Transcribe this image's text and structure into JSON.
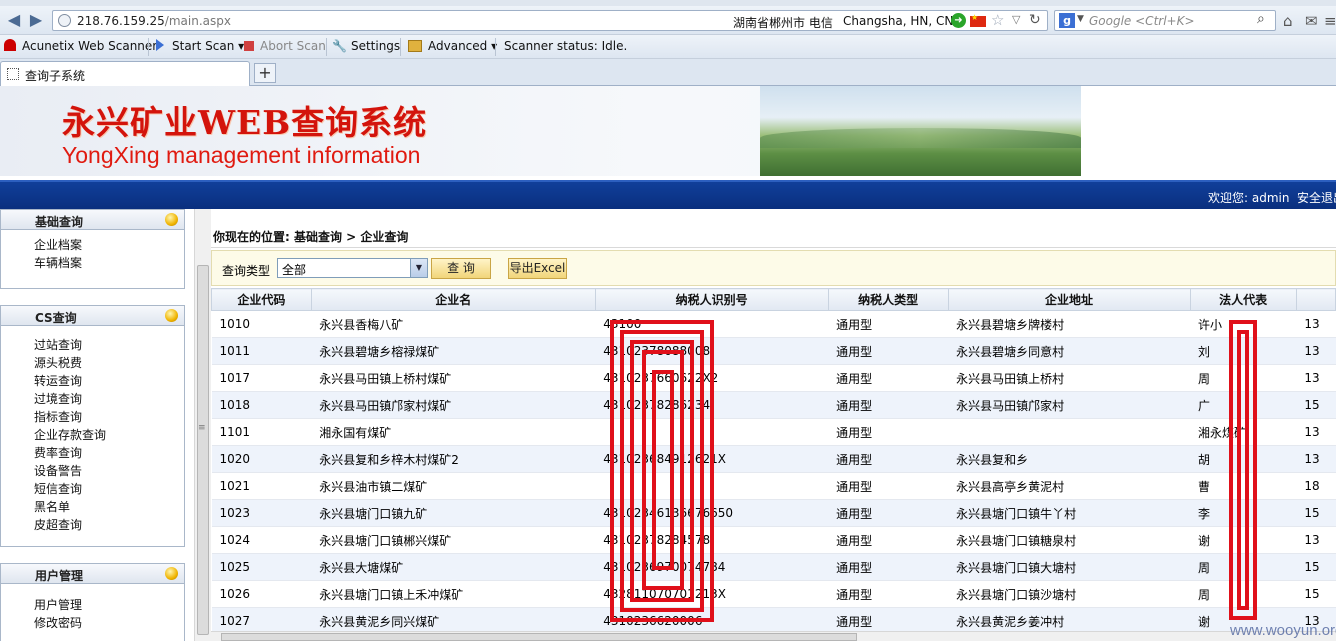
{
  "browser": {
    "url_host": "218.76.159.25",
    "url_path": "/main.aspx",
    "geo_location": "湖南省郴州市 电信",
    "geo_city": "Changsha, HN, CN",
    "search_placeholder": "Google <Ctrl+K>",
    "tab_title": "查询子系统",
    "new_tab": "+"
  },
  "acunetix_toolbar": {
    "brand": "Acunetix Web Scanner",
    "start_scan": "Start Scan",
    "abort_scan": "Abort Scan",
    "settings": "Settings",
    "advanced": "Advanced",
    "status": "Scanner status: Idle."
  },
  "banner": {
    "title_cn": "永兴矿业WEB查询系统",
    "title_en": "YongXing management information"
  },
  "userbar": {
    "welcome": "欢迎您: admin",
    "logout": "安全退出"
  },
  "sidebar": {
    "panels": [
      {
        "title": "基础查询",
        "items": [
          "企业档案",
          "车辆档案"
        ]
      },
      {
        "title": "CS查询",
        "items": [
          "过站查询",
          "源头税费",
          "转运查询",
          "过境查询",
          "指标查询",
          "企业存款查询",
          "费率查询",
          "设备警告",
          "短信查询",
          "黑名单",
          "皮超查询"
        ]
      },
      {
        "title": "用户管理",
        "items": [
          "用户管理",
          "修改密码"
        ]
      }
    ]
  },
  "main": {
    "breadcrumb": "你现在的位置: 基础查询 > 企业查询",
    "query_type_label": "查询类型",
    "query_type_value": "全部",
    "query_button": "查 询",
    "export_button": "导出Excel",
    "columns": [
      "企业代码",
      "企业名",
      "纳税人识别号",
      "纳税人类型",
      "企业地址",
      "法人代表"
    ],
    "rows": [
      [
        "1010",
        "永兴县香梅八矿",
        "43100",
        "通用型",
        "永兴县碧塘乡牌楼村",
        "许小",
        "13"
      ],
      [
        "1011",
        "永兴县碧塘乡榕禄煤矿",
        "43102378088008",
        "通用型",
        "永兴县碧塘乡同意村",
        "刘",
        "13"
      ],
      [
        "1017",
        "永兴县马田镇上桥村煤矿",
        "4310237660622X2",
        "通用型",
        "永兴县马田镇上桥村",
        "周",
        "13"
      ],
      [
        "1018",
        "永兴县马田镇邝家村煤矿",
        "43102378286234",
        "通用型",
        "永兴县马田镇邝家村",
        "广",
        "15"
      ],
      [
        "1101",
        "湘永国有煤矿",
        "",
        "通用型",
        "",
        "湘永煤矿",
        "13"
      ],
      [
        "1020",
        "永兴县复和乡梓木村煤矿2",
        "431023684912621X",
        "通用型",
        "永兴县复和乡",
        "胡",
        "13"
      ],
      [
        "1021",
        "永兴县油市镇二煤矿",
        "",
        "通用型",
        "永兴县高亭乡黄泥村",
        "曹",
        "18"
      ],
      [
        "1023",
        "永兴县塘门口镇九矿",
        "43102346136676650",
        "通用型",
        "永兴县塘门口镇牛丫村",
        "李",
        "15"
      ],
      [
        "1024",
        "永兴县塘门口镇郴兴煤矿",
        "43102378284578",
        "通用型",
        "永兴县塘门口镇糖泉村",
        "谢",
        "13"
      ],
      [
        "1025",
        "永兴县大塘煤矿",
        "4310236970074784",
        "通用型",
        "永兴县塘门口镇大塘村",
        "周",
        "15"
      ],
      [
        "1026",
        "永兴县塘门口镇上禾冲煤矿",
        "432811070701213X",
        "通用型",
        "永兴县塘门口镇沙塘村",
        "周",
        "15"
      ],
      [
        "1027",
        "永兴县黄泥乡同兴煤矿",
        "4310236620006",
        "通用型",
        "永兴县黄泥乡姜冲村",
        "谢",
        "13"
      ]
    ]
  },
  "watermark": "www.wooyun.org",
  "colors": {
    "accent_blue": "#0a2f7e",
    "banner_red": "#d3140c",
    "redaction_red": "#e0101a"
  }
}
